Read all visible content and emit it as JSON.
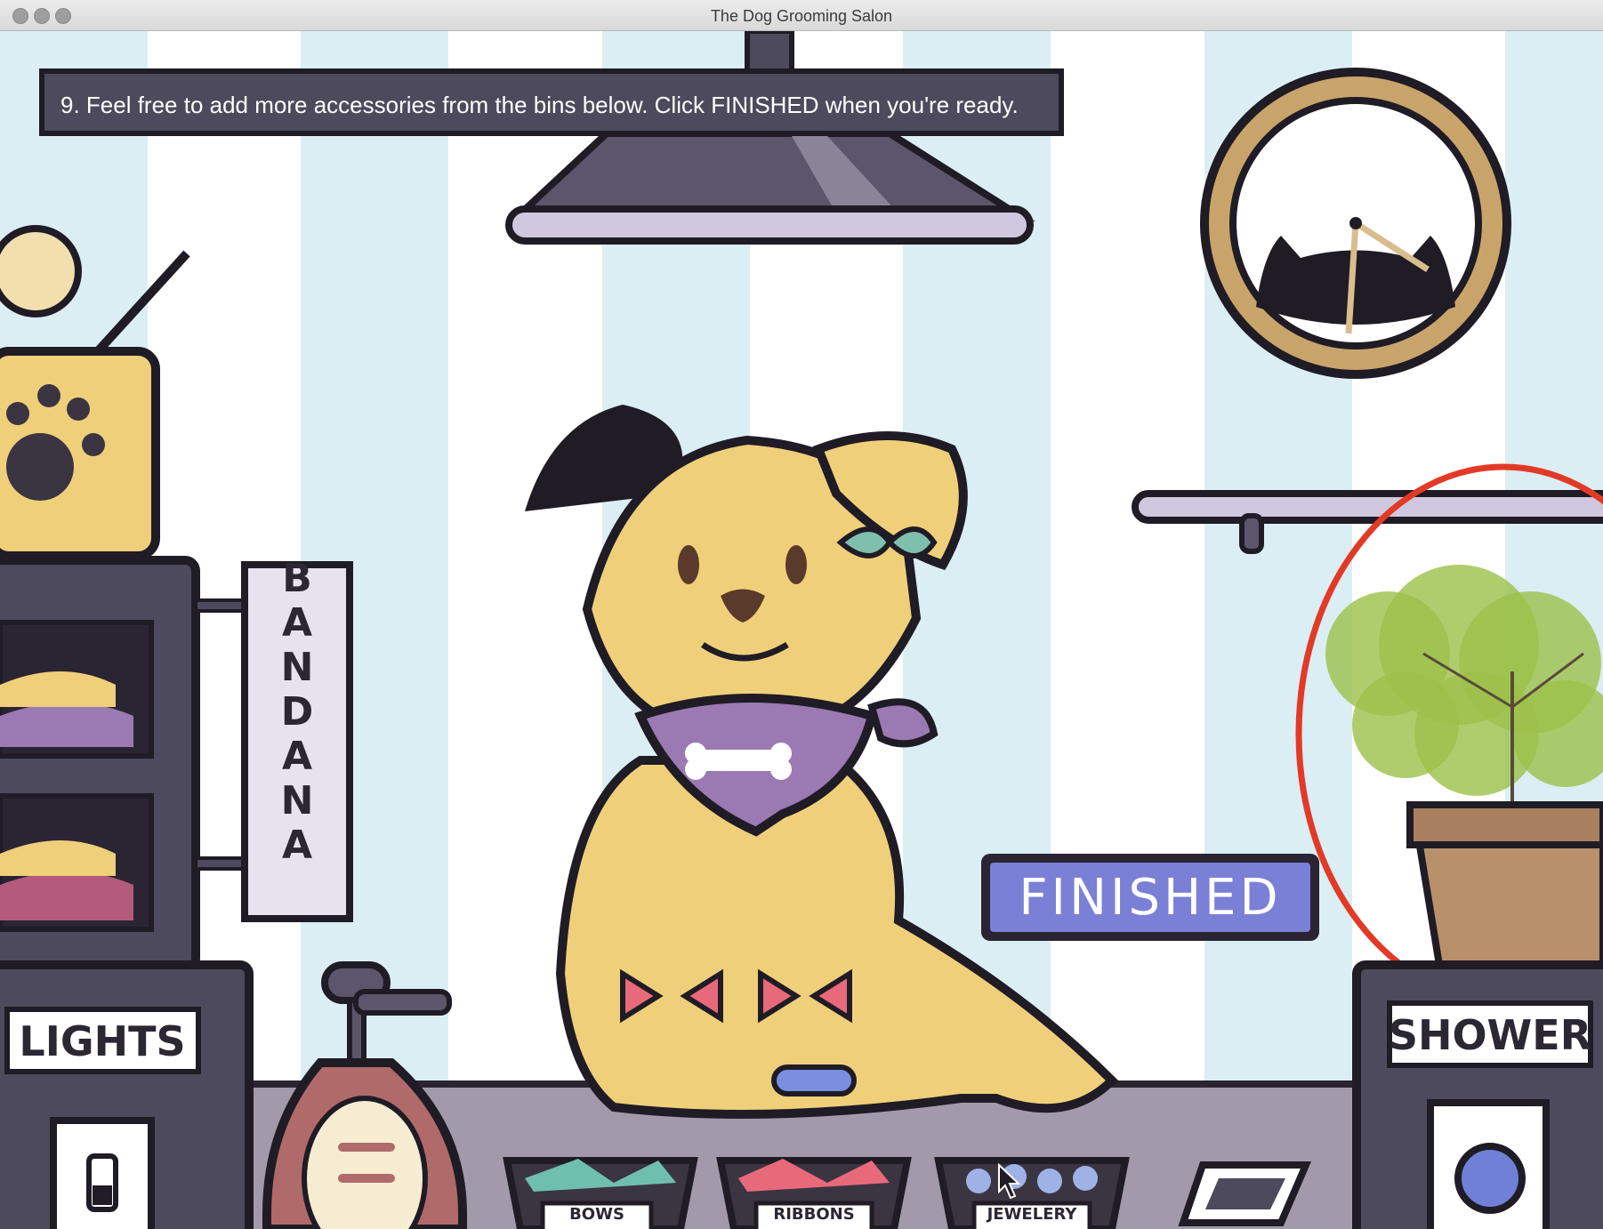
{
  "window": {
    "title": "The Dog Grooming Salon"
  },
  "instruction": {
    "text": "9. Feel free to add more accessories from the bins below. Click FINISHED when you're ready."
  },
  "finished_button": {
    "label": "FINISHED"
  },
  "signs": {
    "bandana": "BANDANA",
    "lights": "LIGHTS",
    "shower": "SHOWER"
  },
  "bins": [
    {
      "label": "BOWS"
    },
    {
      "label": "RIBBONS"
    },
    {
      "label": "JEWELERY"
    }
  ],
  "colors": {
    "stripe": "#dbeef3",
    "instruction_bg": "#4c4a5c",
    "finished_bg": "#7a80d6",
    "outline": "#1f1c26",
    "dog": "#f0cf7a",
    "bandana": "#9b79b3",
    "annotation": "#e23a26"
  }
}
